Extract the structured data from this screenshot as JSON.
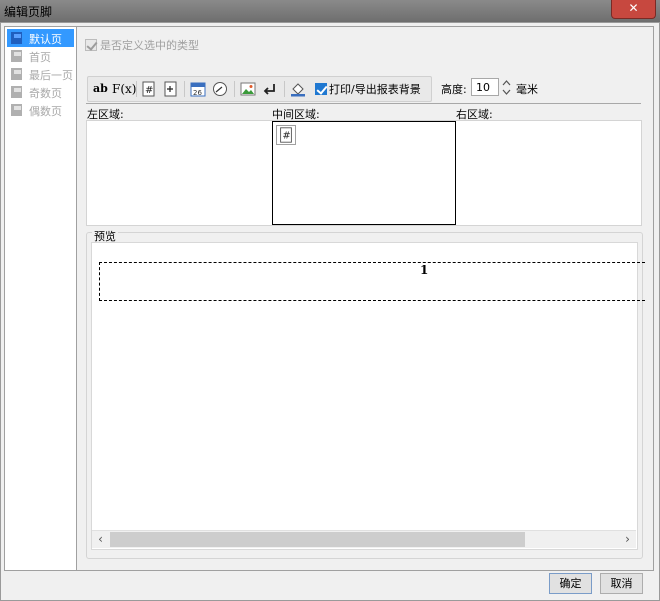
{
  "window": {
    "title": "编辑页脚",
    "close_label": "✕"
  },
  "sidebar": {
    "items": [
      {
        "label": "默认页",
        "selected": true
      },
      {
        "label": "首页",
        "selected": false
      },
      {
        "label": "最后一页",
        "selected": false
      },
      {
        "label": "奇数页",
        "selected": false
      },
      {
        "label": "偶数页",
        "selected": false
      }
    ]
  },
  "options": {
    "custom_type_label": "是否定义选中的类型",
    "custom_type_checked": true
  },
  "toolbar": {
    "text_label": "ab",
    "formula_label": "F(x)",
    "print_bg_label": "打印/导出报表背景",
    "print_bg_checked": true,
    "height_label": "高度:",
    "height_value": "10",
    "height_unit": "毫米"
  },
  "zones": {
    "left_label": "左区域:",
    "center_label": "中间区域:",
    "right_label": "右区域:"
  },
  "preview": {
    "label": "预览",
    "page_number": "1"
  },
  "buttons": {
    "ok": "确定",
    "cancel": "取消"
  },
  "colors": {
    "selection": "#3399ff",
    "titlebar": "#7a7a7a",
    "close": "#c7483f",
    "checkbox_blue": "#1f78d1"
  }
}
